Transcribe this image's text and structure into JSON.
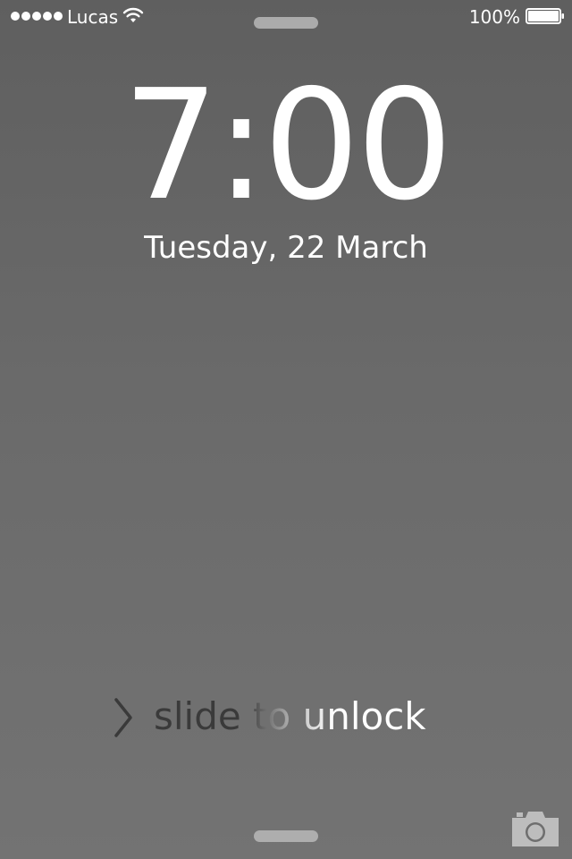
{
  "status_bar": {
    "signal_bars": 5,
    "signal_icon": "signal-dots-icon",
    "carrier": "Lucas",
    "wifi_icon": "wifi-icon",
    "battery_percent": "100%",
    "battery_level": 1.0,
    "battery_icon": "battery-icon"
  },
  "lock_screen": {
    "time": "7:00",
    "date": "Tuesday, 22 March",
    "unlock_label": "slide to unlock",
    "unlock_icon": "chevron-right-icon",
    "camera_icon": "camera-icon"
  },
  "colors": {
    "background": "#666666",
    "text": "#ffffff",
    "grabber": "#b9b9b9",
    "camera": "#bdbdbd"
  }
}
